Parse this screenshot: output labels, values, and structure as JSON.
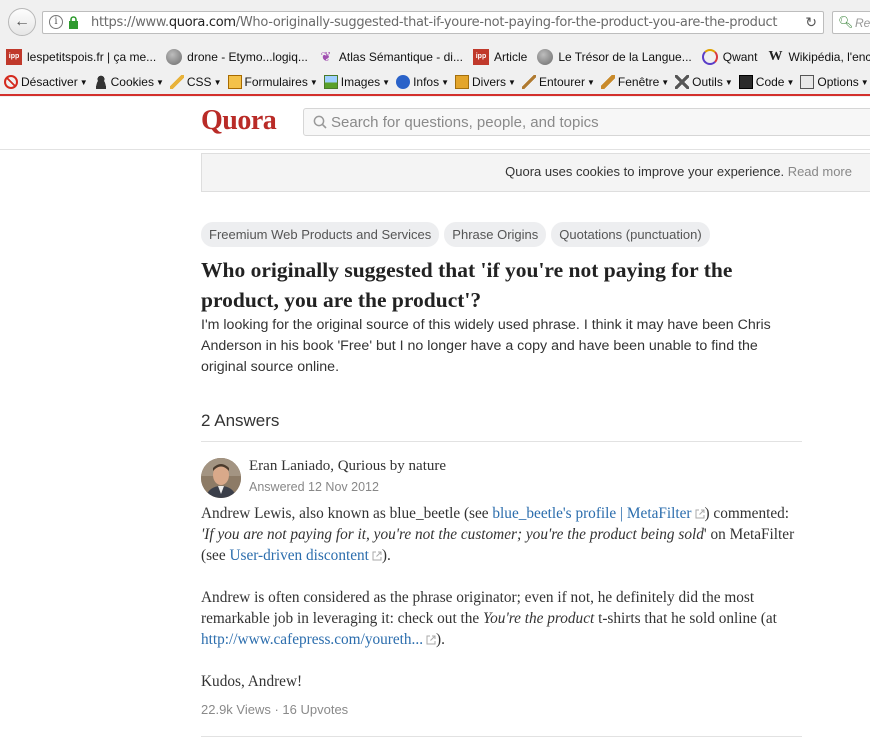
{
  "browser": {
    "url_prefix": "https://www.",
    "url_domain": "quora.com",
    "url_path": "/Who-originally-suggested-that-if-youre-not-paying-for-the-product-you-are-the-product",
    "search_placeholder": "Re",
    "bookmarks": [
      {
        "label": "lespetitspois.fr | ça me...",
        "icon": "ipp-favicon",
        "color": "#c0392b"
      },
      {
        "label": "drone - Etymo...logiq...",
        "icon": "globe-icon",
        "color": "#6b6b6b"
      },
      {
        "label": "Atlas Sémantique - di...",
        "icon": "tree-icon",
        "color": "#a04fb0"
      },
      {
        "label": "Article",
        "icon": "ipp-favicon",
        "color": "#c0392b"
      },
      {
        "label": "Le Trésor de la Langue...",
        "icon": "globe-icon",
        "color": "#6b6b6b"
      },
      {
        "label": "Qwant",
        "icon": "qwant-icon",
        "color": "#5a3ec8"
      },
      {
        "label": "Wikipédia, l'ency",
        "icon": "wikipedia-icon",
        "color": "#222222"
      }
    ],
    "toolbar": [
      {
        "label": "Désactiver",
        "icon": "disable-icon"
      },
      {
        "label": "Cookies",
        "icon": "user-icon"
      },
      {
        "label": "CSS",
        "icon": "pencil-icon"
      },
      {
        "label": "Formulaires",
        "icon": "form-icon"
      },
      {
        "label": "Images",
        "icon": "image-icon"
      },
      {
        "label": "Infos",
        "icon": "info-icon"
      },
      {
        "label": "Divers",
        "icon": "folder-icon"
      },
      {
        "label": "Entourer",
        "icon": "outline-icon"
      },
      {
        "label": "Fenêtre",
        "icon": "ruler-icon"
      },
      {
        "label": "Outils",
        "icon": "tools-icon"
      },
      {
        "label": "Code",
        "icon": "code-icon"
      },
      {
        "label": "Options",
        "icon": "options-icon"
      }
    ]
  },
  "site": {
    "logo": "Quora",
    "search_placeholder": "Search for questions, people, and topics",
    "cookie_text": "Quora uses cookies to improve your experience.",
    "cookie_link": "Read more",
    "brand_color": "#b92b27"
  },
  "question": {
    "topics": [
      "Freemium Web Products and Services",
      "Phrase Origins",
      "Quotations (punctuation)"
    ],
    "title": "Who originally suggested that 'if you're not paying for the product, you are the product'?",
    "details": "I'm looking for the original source of this widely used phrase. I think it may have been Chris Anderson in his book 'Free' but I no longer have a copy and have been unable to find the original source online.",
    "answers_count": "2 Answers"
  },
  "answer": {
    "author": "Eran Laniado, Qurious by nature",
    "answered": "Answered 12 Nov 2012",
    "p1_a": "Andrew Lewis, also known as blue_beetle (see ",
    "p1_link1": "blue_beetle's profile | MetaFilter",
    "p1_b": ") commented: ",
    "p1_quote": "'If you are not paying for it, you're not the customer; you're the product being sold",
    "p1_c": "' on MetaFilter (see ",
    "p1_link2": "User-driven discontent",
    "p1_d": ").",
    "p2_a": "Andrew is often considered as the phrase originator; even if not, he definitely did the most remarkable job in leveraging it: check out the ",
    "p2_italic": "You're the product",
    "p2_b": " t-shirts that he sold online (at ",
    "p2_link": "http://www.cafepress.com/youreth...",
    "p2_c": ").",
    "p3": "Kudos, Andrew!",
    "views": "22.9k Views",
    "sep": " · ",
    "upvotes": "16 Upvotes"
  }
}
